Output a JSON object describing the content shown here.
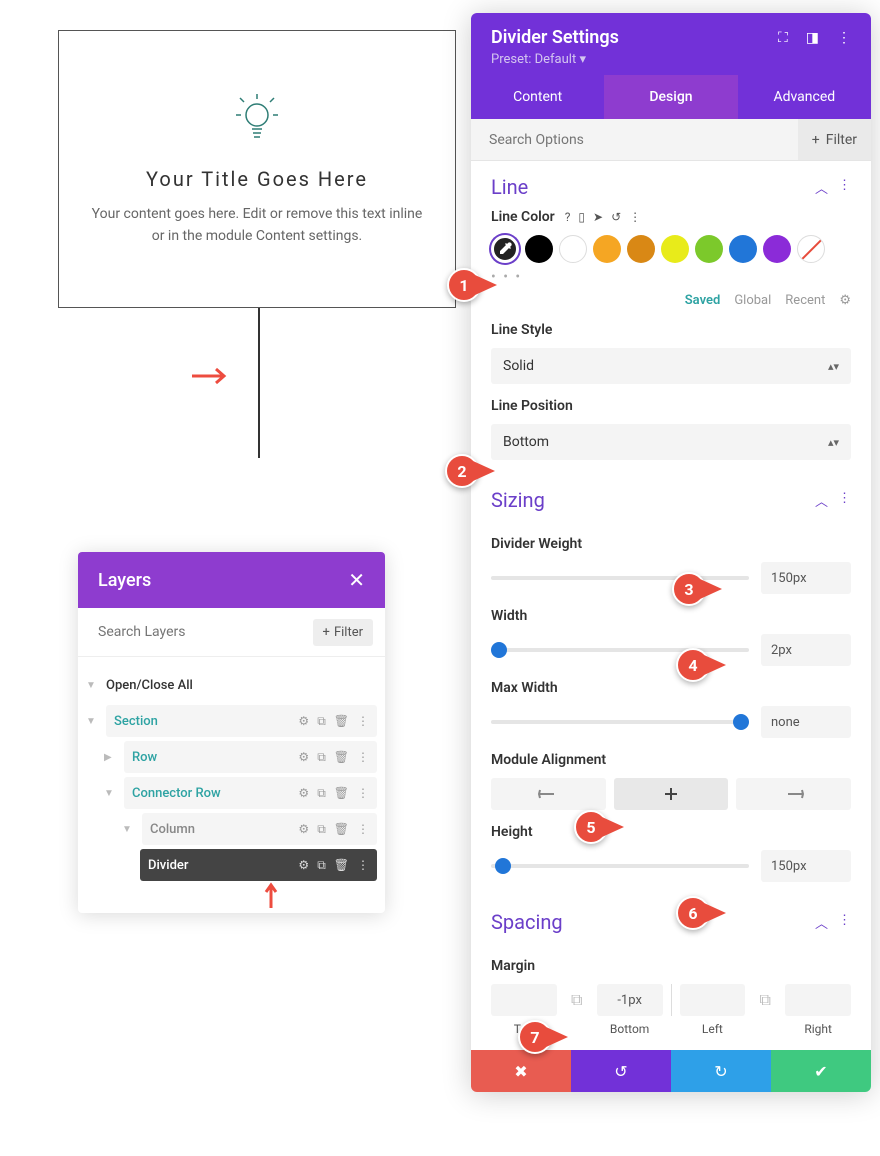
{
  "preview": {
    "title": "Your Title Goes Here",
    "body": "Your content goes here. Edit or remove this text inline or in the module Content settings."
  },
  "layers": {
    "title": "Layers",
    "search_placeholder": "Search Layers",
    "filter": "Filter",
    "open_close": "Open/Close All",
    "items": {
      "section": "Section",
      "row": "Row",
      "connector_row": "Connector Row",
      "column": "Column",
      "divider": "Divider"
    }
  },
  "settings": {
    "title": "Divider Settings",
    "preset": "Preset: Default",
    "tabs": {
      "content": "Content",
      "design": "Design",
      "advanced": "Advanced"
    },
    "search_placeholder": "Search Options",
    "filter": "Filter",
    "sections": {
      "line": "Line",
      "sizing": "Sizing",
      "spacing": "Spacing"
    },
    "line": {
      "color_label": "Line Color",
      "color_tabs": {
        "saved": "Saved",
        "global": "Global",
        "recent": "Recent"
      },
      "style_label": "Line Style",
      "style_value": "Solid",
      "position_label": "Line Position",
      "position_value": "Bottom"
    },
    "sizing": {
      "weight_label": "Divider Weight",
      "weight_value": "150px",
      "width_label": "Width",
      "width_value": "2px",
      "maxwidth_label": "Max Width",
      "maxwidth_value": "none",
      "align_label": "Module Alignment",
      "height_label": "Height",
      "height_value": "150px"
    },
    "spacing": {
      "margin_label": "Margin",
      "top": "Top",
      "bottom": "Bottom",
      "left": "Left",
      "right": "Right",
      "bottom_value": "-1px"
    }
  },
  "callouts": [
    "1",
    "2",
    "3",
    "4",
    "5",
    "6",
    "7"
  ]
}
